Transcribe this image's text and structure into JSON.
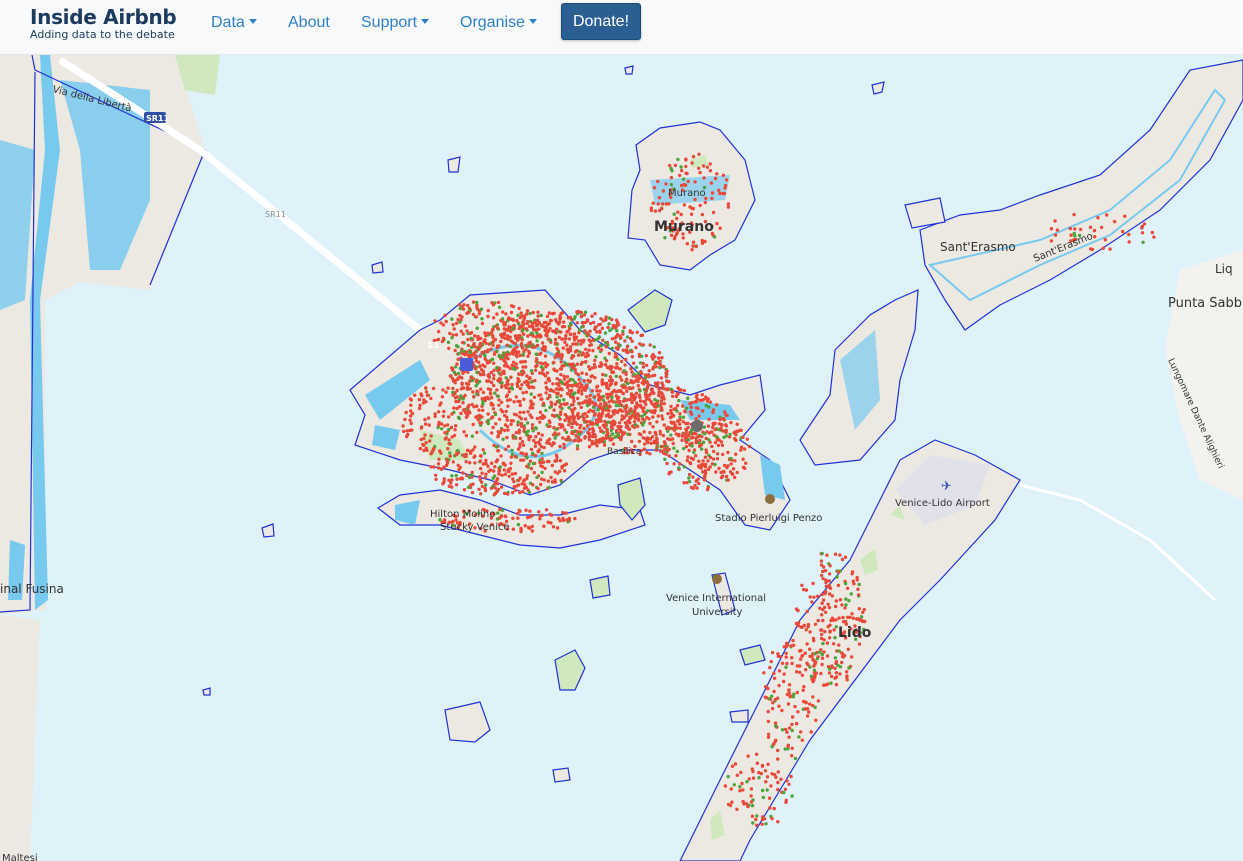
{
  "brand": {
    "title": "Inside Airbnb",
    "tagline": "Adding data to the debate"
  },
  "nav": {
    "data": "Data",
    "about": "About",
    "support": "Support",
    "organise": "Organise",
    "donate": "Donate!"
  },
  "map": {
    "labels": {
      "murano_area": "Murano",
      "murano_town": "Murano",
      "santerasmo": "Sant'Erasmo",
      "santerasmo_road": "Sant'Erasmo",
      "lido": "Lido",
      "airport": "Venice-Lido Airport",
      "hilton": "Hilton Molino",
      "hilton2": "Stucky Venice",
      "university": "Venice International",
      "university2": "University",
      "stadio": "Stadio Pierluigi Penzo",
      "basilica": "Basilica",
      "fusina": "inal Fusina",
      "punta": "Punta Sabbi",
      "liq": "Liq",
      "maltesi": "Maltesi",
      "lungomare": "Lungomare Dante Alighieri",
      "via_liberta": "Via della Libertà",
      "sr11": "SR11",
      "sr11b": "SR11",
      "shield": "11"
    },
    "colors": {
      "water": "#dff2fa",
      "land": "#ece9e3",
      "park": "#cfe8bd",
      "canal": "#78c9ee",
      "boundary": "#1f31d6",
      "entire_home": "#e8493a",
      "private_room": "#4da33b"
    }
  }
}
